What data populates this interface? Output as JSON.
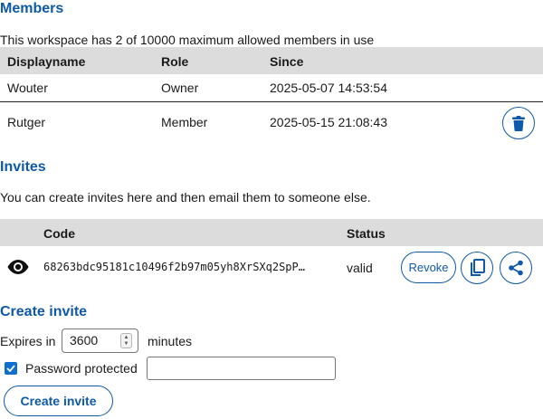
{
  "members": {
    "heading": "Members",
    "summary": "This workspace has 2 of 10000 maximum allowed members in use",
    "columns": [
      "Displayname",
      "Role",
      "Since"
    ],
    "rows": [
      {
        "name": "Wouter",
        "role": "Owner",
        "since": "2025-05-07 14:53:54"
      },
      {
        "name": "Rutger",
        "role": "Member",
        "since": "2025-05-15 21:08:43"
      }
    ],
    "delete_icon": "trash-icon"
  },
  "invites": {
    "heading": "Invites",
    "summary": "You can create invites here and then email them to someone else.",
    "columns": [
      "Code",
      "Status"
    ],
    "rows": [
      {
        "code": "68263bdc95181c10496f2b97m05yh8XrSXq2SpP…",
        "status": "valid",
        "revoke_label": "Revoke"
      }
    ],
    "icons": [
      "eye-icon",
      "copy-icon",
      "share-icon"
    ]
  },
  "create_invite": {
    "heading": "Create invite",
    "expires_label": "Expires in",
    "expires_value": "3600",
    "minutes_label": "minutes",
    "password_label": "Password protected",
    "password_checked": true,
    "password_value": "",
    "button_label": "Create invite"
  },
  "colors": {
    "accent": "#0f5aa8",
    "header_bg": "#dcdcdc"
  }
}
